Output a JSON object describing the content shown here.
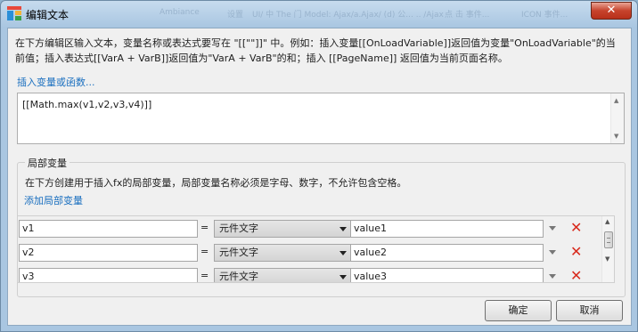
{
  "window": {
    "title": "编辑文本",
    "close_icon": "close-icon",
    "background_ghost": [
      "Ambiance",
      "设置",
      "UI/ 中 The 门 Model: Ajax/a.Ajax/ (d) 公... .. /Ajax",
      "点 击 事件...",
      "ICON 事件..."
    ]
  },
  "instructions": "在下方编辑区输入文本，变量名称或表达式要写在 \"[[\"\"]]\" 中。例如：插入变量[[OnLoadVariable]]返回值为变量\"OnLoadVariable\"的当前值；插入表达式[[VarA + VarB]]返回值为\"VarA + VarB\"的和；插入 [[PageName]] 返回值为当前页面名称。",
  "insert_link": "插入变量或函数...",
  "expression": "[[Math.max(v1,v2,v3,v4)]]",
  "local_vars": {
    "title": "局部变量",
    "description": "在下方创建用于插入fx的局部变量，局部变量名称必须是字母、数字，不允许包含空格。",
    "add_link": "添加局部变量",
    "rows": [
      {
        "name": "v1",
        "eq": "=",
        "type": "元件文字",
        "value": "value1"
      },
      {
        "name": "v2",
        "eq": "=",
        "type": "元件文字",
        "value": "value2"
      },
      {
        "name": "v3",
        "eq": "=",
        "type": "元件文字",
        "value": "value3"
      }
    ],
    "delete_symbol": "✕"
  },
  "buttons": {
    "ok": "确定",
    "cancel": "取消"
  },
  "colors": {
    "link": "#1a6fbf",
    "delete": "#d82a1d",
    "close": "#c7432c"
  }
}
